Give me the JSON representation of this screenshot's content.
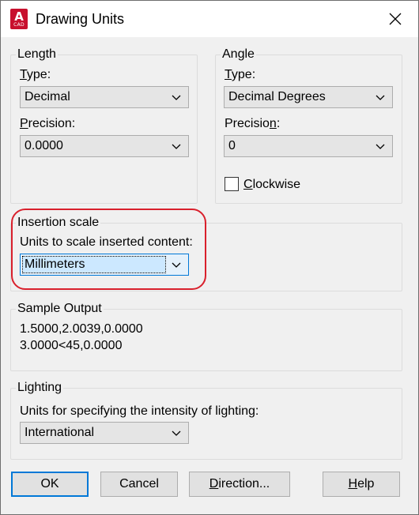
{
  "window": {
    "title": "Drawing Units",
    "app_icon_letter": "A",
    "app_icon_sub": "CAD"
  },
  "length": {
    "legend": "Length",
    "type_label_u": "T",
    "type_label_rest": "ype:",
    "type_value": "Decimal",
    "precision_label_u": "P",
    "precision_label_rest": "recision:",
    "precision_value": "0.0000"
  },
  "angle": {
    "legend": "Angle",
    "type_label_u": "T",
    "type_label_rest": "ype:",
    "type_value": "Decimal Degrees",
    "precision_label_a": "Precisio",
    "precision_label_u": "n",
    "precision_label_b": ":",
    "precision_value": "0",
    "clockwise_u": "C",
    "clockwise_rest": "lockwise",
    "clockwise_checked": false
  },
  "insertion": {
    "legend": "Insertion scale",
    "label": "Units to scale inserted content:",
    "value": "Millimeters"
  },
  "sample": {
    "legend": "Sample Output",
    "line1": "1.5000,2.0039,0.0000",
    "line2": "3.0000<45,0.0000"
  },
  "lighting": {
    "legend": "Lighting",
    "label": "Units for specifying the intensity of lighting:",
    "value": "International"
  },
  "buttons": {
    "ok": "OK",
    "cancel": "Cancel",
    "direction_u": "D",
    "direction_rest": "irection...",
    "help_u": "H",
    "help_rest": "elp"
  },
  "colors": {
    "accent": "#0078d7",
    "highlight": "#d9202c",
    "app_icon": "#c8102e"
  }
}
